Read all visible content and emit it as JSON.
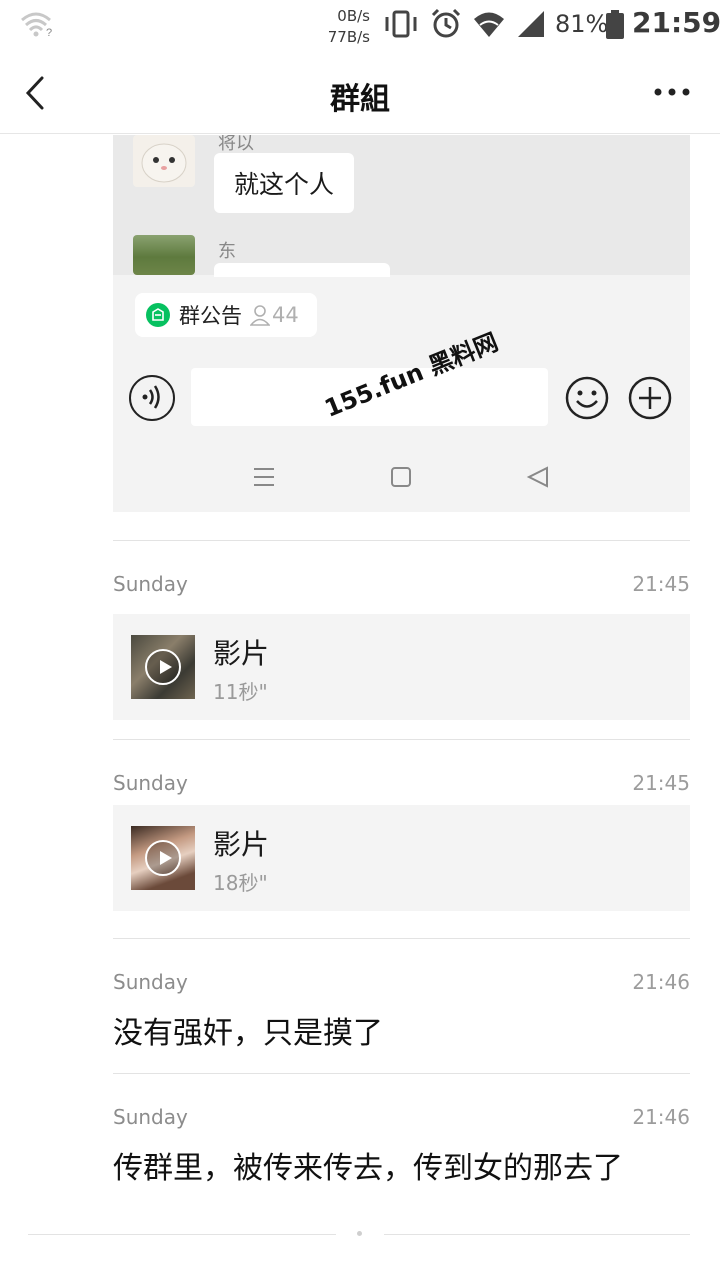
{
  "status_bar": {
    "speed_down": "0B/s",
    "speed_up": "77B/s",
    "battery": "81%",
    "time": "21:59",
    "icons": [
      "wifi-question-icon",
      "vibrate-icon",
      "alarm-icon",
      "wifi-icon",
      "signal-icon",
      "battery-icon"
    ]
  },
  "header": {
    "title": "群組",
    "back_icon": "chevron-left-icon",
    "more_icon": "more-dots-icon"
  },
  "embedded_screenshot": {
    "sender_1": "将以",
    "bubble_1": "就这个人",
    "sender_2": "东",
    "announcement_label": "群公告",
    "announcement_count": "44",
    "watermark": "155.fun 黑料网"
  },
  "items": [
    {
      "source": "Sunday",
      "time": "21:45",
      "type": "video",
      "title": "影片",
      "duration": "11秒\""
    },
    {
      "source": "Sunday",
      "time": "21:45",
      "type": "video",
      "title": "影片",
      "duration": "18秒\""
    },
    {
      "source": "Sunday",
      "time": "21:46",
      "type": "text",
      "text": "没有强奸，只是摸了"
    },
    {
      "source": "Sunday",
      "time": "21:46",
      "type": "text",
      "text": "传群里，被传来传去，传到女的那去了"
    }
  ],
  "colors": {
    "accent_green": "#07c160",
    "background": "#ffffff",
    "card": "#f4f4f4"
  }
}
